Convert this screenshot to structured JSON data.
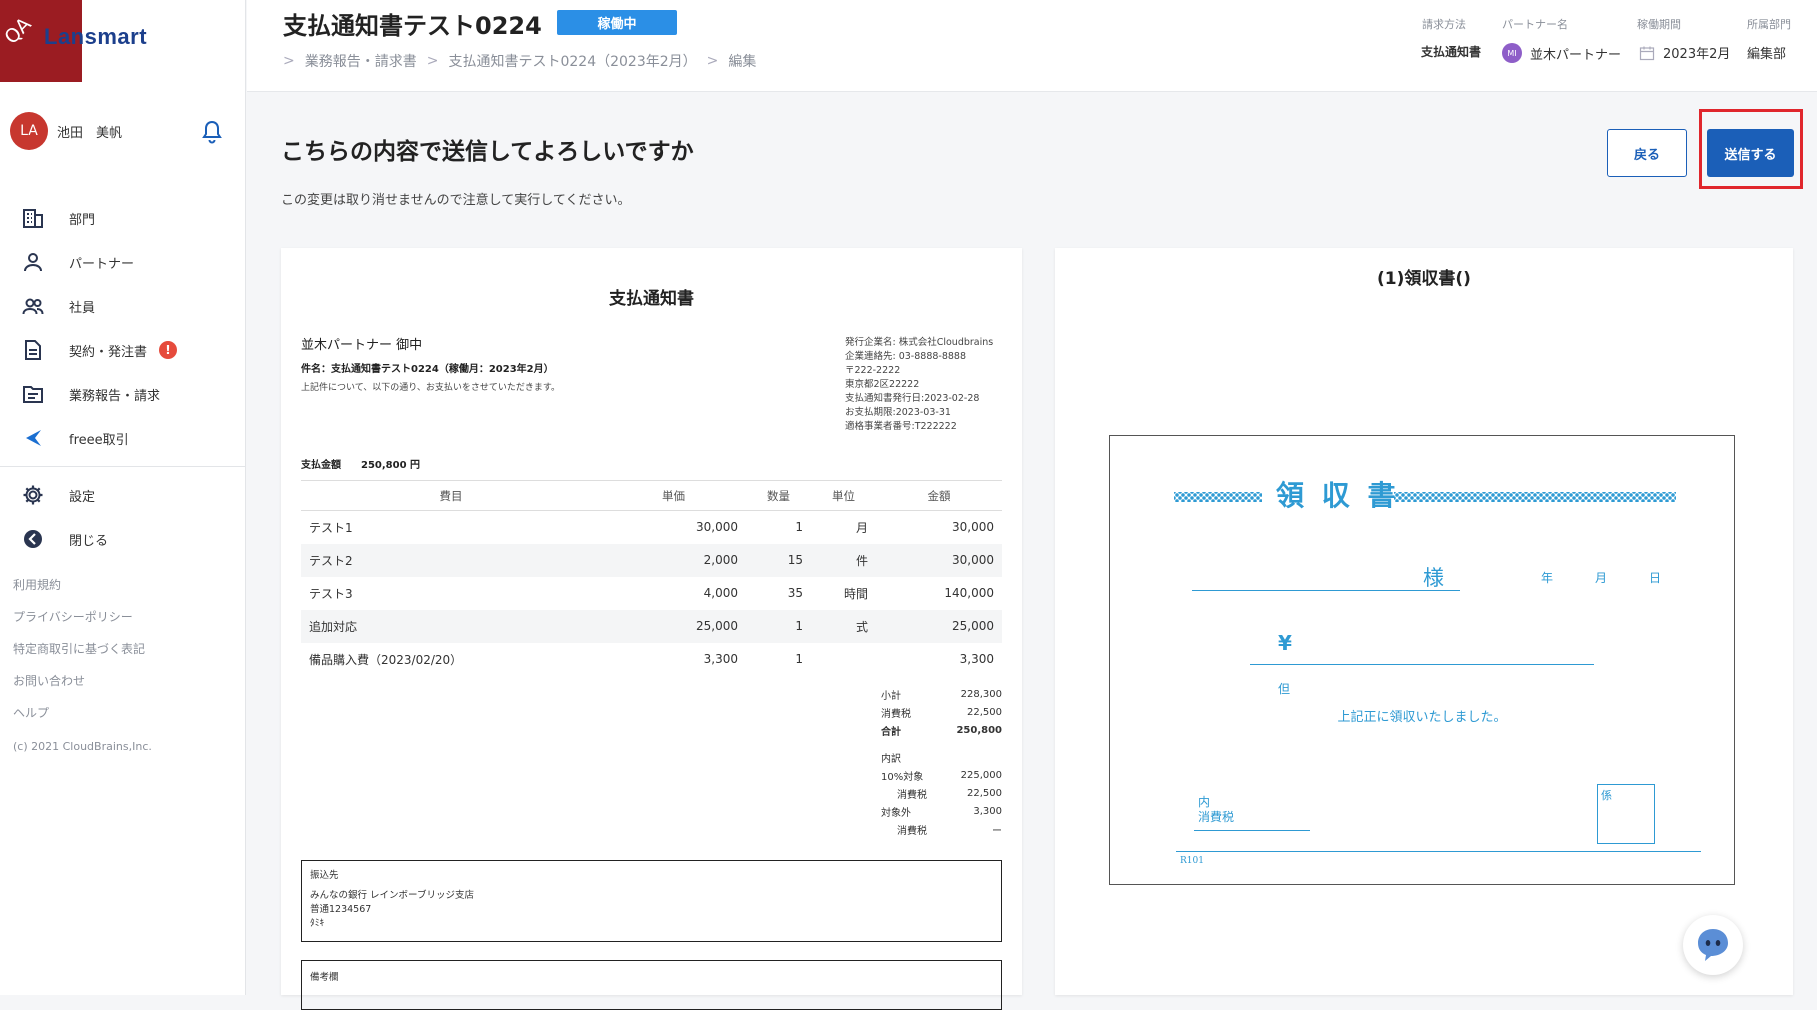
{
  "corner_badge": "QA",
  "app": {
    "logo": "Lansmart"
  },
  "user": {
    "initials": "LA",
    "name": "池田　美帆"
  },
  "sidebar": {
    "items": [
      {
        "label": "部門",
        "icon": "building-icon"
      },
      {
        "label": "パートナー",
        "icon": "person-icon"
      },
      {
        "label": "社員",
        "icon": "people-icon"
      },
      {
        "label": "契約・発注書",
        "icon": "document-icon",
        "badge": "!"
      },
      {
        "label": "業務報告・請求",
        "icon": "folder-icon"
      },
      {
        "label": "freee取引",
        "icon": "freee-icon"
      }
    ],
    "settings": "設定",
    "close": "閉じる",
    "links": [
      "利用規約",
      "プライバシーポリシー",
      "特定商取引に基づく表記",
      "お問い合わせ",
      "ヘルプ"
    ],
    "copyright": "(c) 2021 CloudBrains,Inc."
  },
  "header": {
    "title": "支払通知書テスト0224",
    "status": "稼働中",
    "breadcrumb": [
      "業務報告・請求書",
      "支払通知書テスト0224（2023年2月）",
      "編集"
    ],
    "meta": {
      "method_label": "請求方法",
      "method_value": "支払通知書",
      "partner_label": "パートナー名",
      "partner_initials": "MI",
      "partner_value": "並木パートナー",
      "period_label": "稼働期間",
      "period_value": "2023年2月",
      "dept_label": "所属部門",
      "dept_value": "編集部"
    }
  },
  "confirm": {
    "title": "こちらの内容で送信してよろしいですか",
    "subtitle": "この変更は取り消せませんので注意して実行してください。",
    "back_label": "戻る",
    "send_label": "送信する"
  },
  "document": {
    "title": "支払通知書",
    "to": "並木パートナー 御中",
    "subject": "件名：支払通知書テスト0224（稼働月：2023年2月）",
    "intro": "上記件について、以下の通り、お支払いをさせていただきます。",
    "issuer": [
      "発行企業名: 株式会社Cloudbrains",
      "企業連絡先: 03-8888-8888",
      "〒222-2222",
      "東京都2区22222",
      "支払通知書発行日:2023-02-28",
      "お支払期限:2023-03-31",
      "適格事業者番号:T222222"
    ],
    "total_label": "支払金額",
    "total_value": "250,800 円",
    "columns": [
      "費目",
      "単価",
      "数量",
      "単位",
      "金額"
    ],
    "rows": [
      [
        "テスト1",
        "30,000",
        "1",
        "月",
        "30,000"
      ],
      [
        "テスト2",
        "2,000",
        "15",
        "件",
        "30,000"
      ],
      [
        "テスト3",
        "4,000",
        "35",
        "時間",
        "140,000"
      ],
      [
        "追加対応",
        "25,000",
        "1",
        "式",
        "25,000"
      ],
      [
        "備品購入費（2023/02/20）",
        "3,300",
        "1",
        "",
        "3,300"
      ]
    ],
    "summary": [
      {
        "label": "小計",
        "value": "228,300"
      },
      {
        "label": "消費税",
        "value": "22,500"
      },
      {
        "label": "合計",
        "value": "250,800"
      }
    ],
    "breakdown_label": "内訳",
    "breakdown": [
      {
        "label": "10%対象",
        "value": "225,000"
      },
      {
        "label": "消費税",
        "value": "22,500"
      },
      {
        "label": "対象外",
        "value": "3,300"
      },
      {
        "label": "消費税",
        "value": "ー"
      }
    ],
    "bank_label": "振込先",
    "bank_lines": [
      "みんなの銀行 レインボーブリッジ支店",
      "普通1234567",
      "ﾀﾐｷ"
    ],
    "notes_label": "備考欄"
  },
  "receipt": {
    "title": "(1)領収書()",
    "heading": "領 収 書",
    "sama": "様",
    "date": [
      "年",
      "月",
      "日"
    ],
    "yen": "¥",
    "tadashi": "但",
    "received": "上記正に領収いたしました。",
    "uchi": "内",
    "tax": "消費税",
    "kakari": "係",
    "code": "R101"
  },
  "colors": {
    "primary": "#1b5fb8",
    "status": "#2b8fe6",
    "receipt": "#2e9ad3",
    "highlight": "#e0262c"
  }
}
